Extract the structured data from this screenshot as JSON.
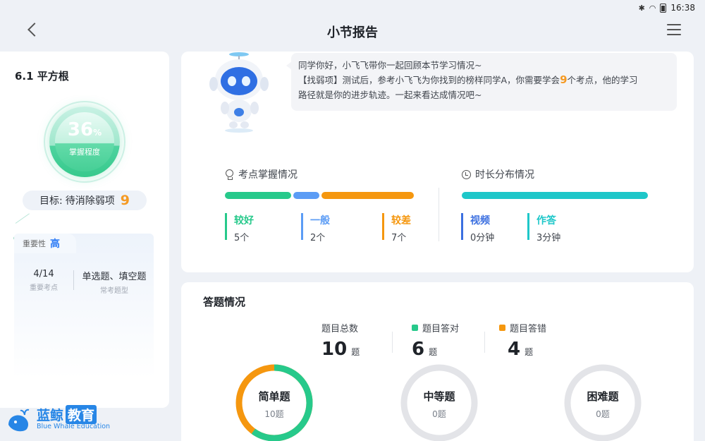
{
  "status": {
    "time": "16:38"
  },
  "header": {
    "title": "小节报告"
  },
  "left": {
    "section_title": "6.1 平方根",
    "mastery_percent": "36",
    "mastery_unit": "%",
    "mastery_label": "掌握程度",
    "goal_label": "目标:",
    "goal_text": "待消除弱项",
    "goal_count": "9",
    "importance_label": "重要性",
    "importance_value": "高",
    "stats": [
      {
        "value": "4/14",
        "label": "重要考点"
      },
      {
        "value": "单选题、填空题",
        "label": "常考题型"
      }
    ]
  },
  "logo": {
    "cn_a": "蓝鲸",
    "cn_b": "教育",
    "en": "Blue Whale Education"
  },
  "speech": {
    "line1": "同学你好，小飞飞带你一起回顾本节学习情况~",
    "line2_pre": "【找弱项】测试后，参考小飞飞为你找到的榜样同学A，你需要学会",
    "line2_num": "9",
    "line2_post": "个考点，他的学习",
    "line3": "路径就是你的进步轨迹。一起来看达成情况吧~"
  },
  "knowledge": {
    "title": "考点掌握情况",
    "items": [
      {
        "label": "较好",
        "count": "5个",
        "value": 5,
        "color": "#27c98b"
      },
      {
        "label": "一般",
        "count": "2个",
        "value": 2,
        "color": "#5b9cf5"
      },
      {
        "label": "较差",
        "count": "7个",
        "value": 7,
        "color": "#f5970f"
      }
    ]
  },
  "duration": {
    "title": "时长分布情况",
    "items": [
      {
        "label": "视频",
        "count": "0分钟",
        "value": 0,
        "color": "#3b6fe0"
      },
      {
        "label": "作答",
        "count": "3分钟",
        "value": 3,
        "color": "#1ec7c9"
      }
    ]
  },
  "answers": {
    "title": "答题情况",
    "total_label": "题目总数",
    "total_value": "10",
    "correct_label": "题目答对",
    "correct_value": "6",
    "wrong_label": "题目答错",
    "wrong_value": "4",
    "unit": "题",
    "colors": {
      "correct": "#27c98b",
      "wrong": "#f5970f",
      "empty": "#e3e4e8"
    },
    "levels": [
      {
        "name": "简单题",
        "count": "10题",
        "correct_fraction": 0.6
      },
      {
        "name": "中等题",
        "count": "0题",
        "correct_fraction": 0
      },
      {
        "name": "困难题",
        "count": "0题",
        "correct_fraction": 0
      }
    ]
  }
}
